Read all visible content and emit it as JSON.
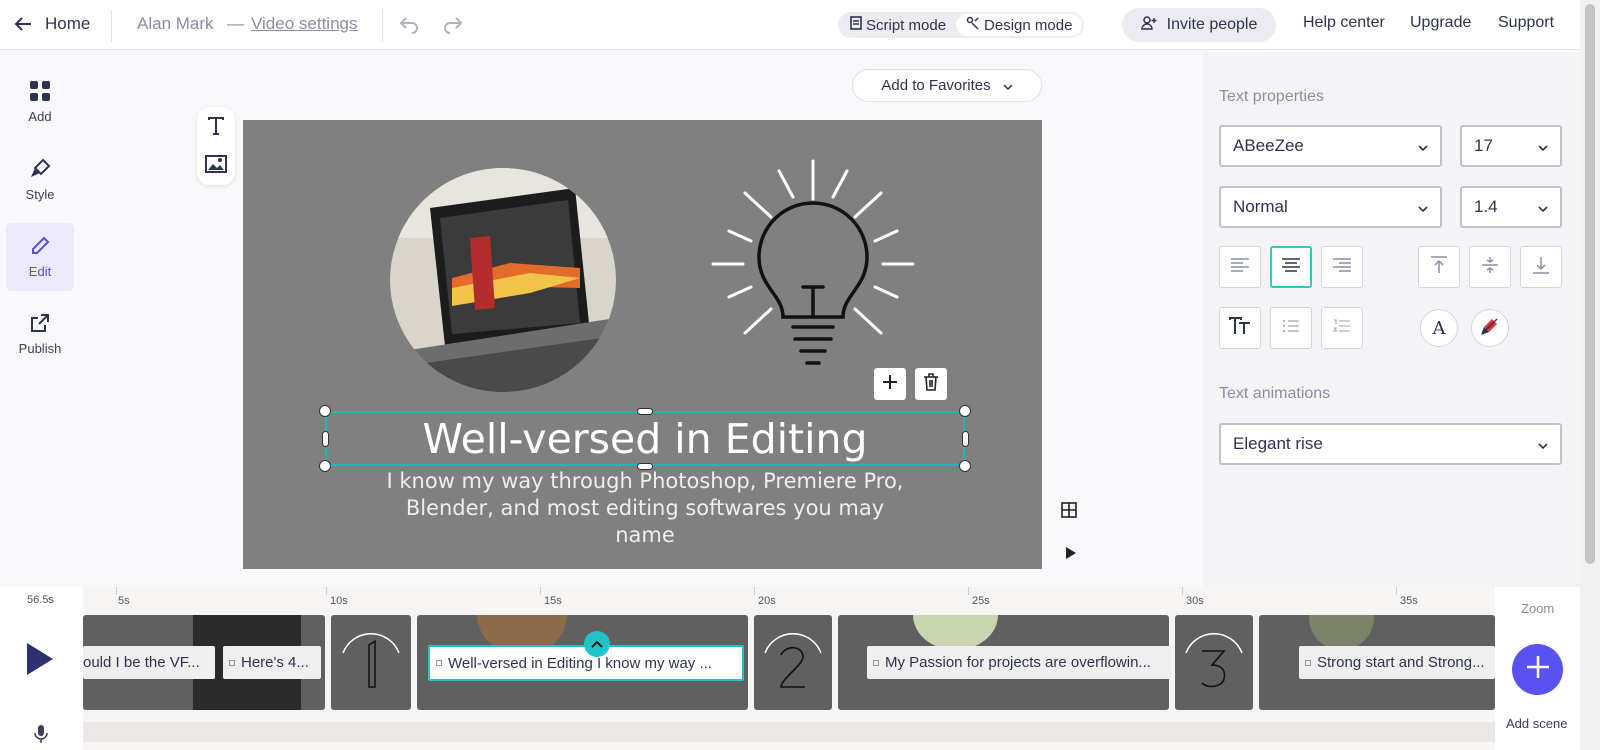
{
  "topbar": {
    "home_label": "Home",
    "user_name": "Alan Mark",
    "dash": "—",
    "video_settings_label": "Video settings",
    "script_mode_label": "Script mode",
    "design_mode_label": "Design mode",
    "invite_label": "Invite people",
    "help_center": "Help center",
    "upgrade": "Upgrade",
    "support": "Support"
  },
  "rail": {
    "items": [
      {
        "label": "Add",
        "icon": "grid-icon"
      },
      {
        "label": "Style",
        "icon": "brush-icon"
      },
      {
        "label": "Edit",
        "icon": "pencil-icon"
      },
      {
        "label": "Publish",
        "icon": "export-icon"
      }
    ]
  },
  "favorites": {
    "label": "Add to Favorites"
  },
  "canvas": {
    "title": "Well-versed in Editing",
    "body": "I know my way through Photoshop, Premiere Pro, Blender, and most editing softwares you may name",
    "background": "#808080",
    "selection_color": "#23b5b8"
  },
  "properties": {
    "heading": "Text properties",
    "font": "ABeeZee",
    "size": "17",
    "weight": "Normal",
    "line_height": "1.4",
    "animations_heading": "Text animations",
    "animation": "Elegant rise",
    "align_selected": "center"
  },
  "timeline": {
    "duration": "56.5s",
    "ticks": [
      "5s",
      "10s",
      "15s",
      "20s",
      "25s",
      "30s",
      "35s"
    ],
    "zoom_label": "Zoom",
    "add_scene_label": "Add scene",
    "scene_numbers": [
      "1",
      "2",
      "3"
    ],
    "labels": [
      "ould I be the VF...",
      "Here's 4...",
      "Well-versed in Editing I know my way ...",
      "My Passion for projects are overflowin...",
      "Strong start and Strong..."
    ]
  },
  "colors": {
    "accent": "#5a52d5",
    "teal": "#23b5b8",
    "dark": "#2e3350"
  }
}
